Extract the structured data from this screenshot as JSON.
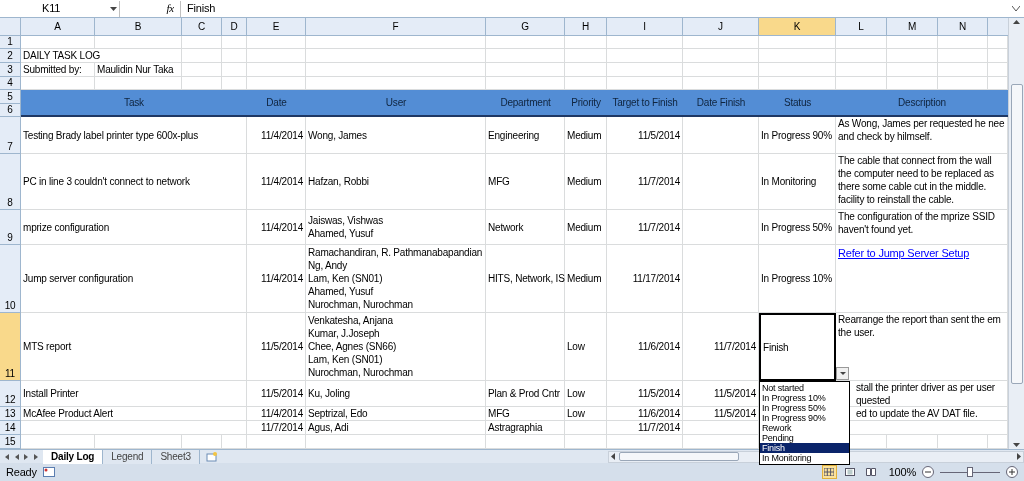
{
  "formula_bar": {
    "name_box": "K11",
    "function_label": "fx",
    "formula": "Finish"
  },
  "columns": [
    {
      "label": "A",
      "selected": false
    },
    {
      "label": "B",
      "selected": false
    },
    {
      "label": "C",
      "selected": false
    },
    {
      "label": "D",
      "selected": false
    },
    {
      "label": "E",
      "selected": false
    },
    {
      "label": "F",
      "selected": false
    },
    {
      "label": "G",
      "selected": false
    },
    {
      "label": "H",
      "selected": false
    },
    {
      "label": "I",
      "selected": false
    },
    {
      "label": "J",
      "selected": false
    },
    {
      "label": "K",
      "selected": true
    },
    {
      "label": "L",
      "selected": false
    },
    {
      "label": "M",
      "selected": false
    },
    {
      "label": "N",
      "selected": false
    }
  ],
  "rows": [
    {
      "kind": "blank",
      "row_numbers": [
        {
          "label": "1",
          "selected": false
        }
      ]
    },
    {
      "kind": "title",
      "row_numbers": [
        {
          "label": "2",
          "selected": false
        }
      ],
      "text": "DAILY TASK LOG"
    },
    {
      "kind": "submitted",
      "row_numbers": [
        {
          "label": "3",
          "selected": false
        }
      ],
      "label": "Submitted by:",
      "value": "Maulidin Nur Taka"
    },
    {
      "kind": "blank",
      "row_numbers": [
        {
          "label": "4",
          "selected": false
        }
      ]
    },
    {
      "kind": "header",
      "row_numbers": [
        {
          "label": "5",
          "selected": false
        },
        {
          "label": "6",
          "selected": false
        }
      ],
      "titles": [
        "Task",
        "Date",
        "User",
        "Department",
        "Priority",
        "Target to Finish",
        "Date Finish",
        "Status",
        "Description"
      ]
    },
    {
      "kind": "record",
      "row_numbers": [
        {
          "label": "7",
          "selected": false
        }
      ],
      "task": "Testing Brady label printer type 600x-plus",
      "date": "11/4/2014",
      "user": [
        "Wong, James"
      ],
      "department": "Engineering",
      "priority": "Medium",
      "target": "11/5/2014",
      "status": "In Progress 90%",
      "status_active": false,
      "description": [
        "As Wong, James per requested he nee",
        "and check by hilmself."
      ]
    },
    {
      "kind": "record",
      "row_numbers": [
        {
          "label": "8",
          "selected": false
        }
      ],
      "task": "PC in line 3 couldn't connect to network",
      "date": "11/4/2014",
      "user": [
        "Hafzan, Robbi"
      ],
      "department": "MFG",
      "priority": "Medium",
      "target": "11/7/2014",
      "status": "In Monitoring",
      "status_active": false,
      "description": [
        "The cable that connect from the wall",
        "the computer need to be replaced as",
        "there some cable cut in the middle.",
        "facility to reinstall the cable."
      ]
    },
    {
      "kind": "record",
      "row_numbers": [
        {
          "label": "9",
          "selected": false
        }
      ],
      "task": "mprize configuration",
      "date": "11/4/2014",
      "user": [
        "Jaiswas, Vishwas",
        "Ahamed, Yusuf"
      ],
      "department": "Network",
      "priority": "Medium",
      "target": "11/7/2014",
      "status": "In Progress 50%",
      "status_active": false,
      "description": [
        "The configuration of the mprize SSID",
        "haven't found yet."
      ]
    },
    {
      "kind": "record",
      "row_numbers": [
        {
          "label": "10",
          "selected": false
        }
      ],
      "task": "Jump server configuration",
      "date": "11/4/2014",
      "user": [
        "Ramachandiran, R. Pathmanabapandian",
        "Ng, Andy",
        "Lam, Ken (SN01)",
        "Ahamed, Yusuf",
        "Nurochman, Nurochman"
      ],
      "department": "HITS, Network, IS",
      "priority": "Medium",
      "target": "11/17/2014",
      "status": "In Progress 10%",
      "status_active": false,
      "description_link": "Refer to Jump Server Setup"
    },
    {
      "kind": "record",
      "row_numbers": [
        {
          "label": "11",
          "selected": true
        }
      ],
      "task": "MTS report",
      "date": "11/5/2014",
      "user": [
        "Venkatesha, Anjana",
        "Kumar, J.Joseph",
        "Chee, Agnes (SN66)",
        "Lam, Ken (SN01)",
        "Nurochman, Nurochman"
      ],
      "priority": "Low",
      "target": "11/6/2014",
      "date_finish": "11/7/2014",
      "status": "Finish",
      "status_active": true,
      "description": [
        "Rearrange the report than sent the em",
        "the user."
      ]
    },
    {
      "kind": "record",
      "row_numbers": [
        {
          "label": "12",
          "selected": false
        }
      ],
      "task": "Install Printer",
      "date": "11/5/2014",
      "user": [
        "Ku, Joling"
      ],
      "department": "Plan & Prod Cntr",
      "priority": "Low",
      "target": "11/5/2014",
      "date_finish": "11/5/2014",
      "description": [
        "stall the printer driver as per user",
        "quested"
      ]
    },
    {
      "kind": "record",
      "row_numbers": [
        {
          "label": "13",
          "selected": false
        }
      ],
      "task": "McAfee Product Alert",
      "date": "11/4/2014",
      "user": [
        "Septrizal, Edo"
      ],
      "department": "MFG",
      "priority": "Low",
      "target": "11/6/2014",
      "date_finish": "11/5/2014",
      "description": [
        "ed to update the AV DAT file."
      ]
    },
    {
      "kind": "record",
      "row_numbers": [
        {
          "label": "14",
          "selected": false
        }
      ],
      "date": "11/7/2014",
      "user": [
        "Agus, Adi"
      ],
      "department": "Astragraphia",
      "target": "11/7/2014"
    },
    {
      "kind": "blank",
      "row_numbers": [
        {
          "label": "15",
          "selected": false
        }
      ]
    }
  ],
  "dropdown": {
    "options": [
      {
        "label": "Not started",
        "selected": false
      },
      {
        "label": "In Progress 10%",
        "selected": false
      },
      {
        "label": "In Progress 50%",
        "selected": false
      },
      {
        "label": "In Progress 90%",
        "selected": false
      },
      {
        "label": "Rework",
        "selected": false
      },
      {
        "label": "Pending",
        "selected": false
      },
      {
        "label": "Finish",
        "selected": true
      },
      {
        "label": "In Monitoring",
        "selected": false
      }
    ]
  },
  "sheet_tabs": [
    {
      "label": "Daily Log",
      "selected": true
    },
    {
      "label": "Legend",
      "selected": false
    },
    {
      "label": "Sheet3",
      "selected": false
    }
  ],
  "status_bar": {
    "status": "Ready",
    "views": [
      {
        "kind": "normal",
        "selected": true
      },
      {
        "kind": "page_layout",
        "selected": false
      },
      {
        "kind": "page_break",
        "selected": false
      }
    ],
    "zoom": "100%",
    "zoom_slider": {
      "level": 0.5
    }
  }
}
